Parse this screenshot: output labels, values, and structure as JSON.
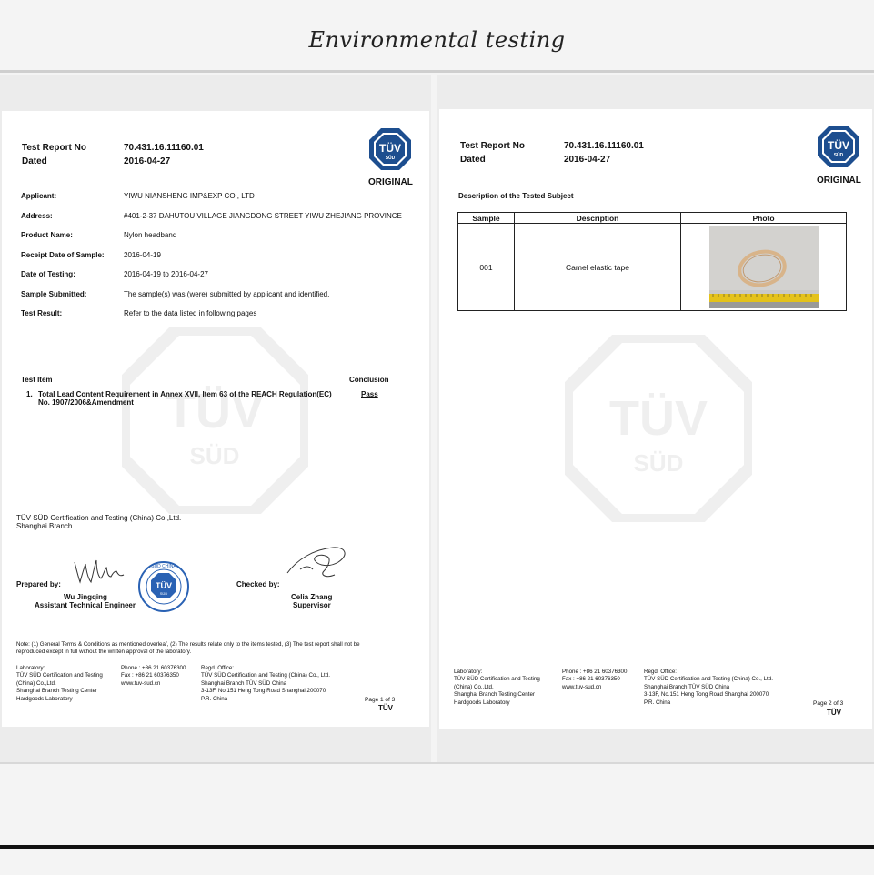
{
  "heading": "Environmental testing",
  "page1": {
    "labels": {
      "report_no": "Test Report No",
      "dated": "Dated"
    },
    "report_no": "70.431.16.11160.01",
    "dated": "2016-04-27",
    "original": "ORIGINAL",
    "logo_top": "TÜV",
    "logo_bottom": "SÜD",
    "fields": [
      {
        "label": "Applicant:",
        "value": "YIWU NIANSHENG IMP&EXP CO., LTD"
      },
      {
        "label": "Address:",
        "value": "#401-2-37 DAHUTOU VILLAGE JIANGDONG STREET YIWU ZHEJIANG PROVINCE"
      },
      {
        "label": "Product Name:",
        "value": "Nylon headband"
      },
      {
        "label": "Receipt Date of Sample:",
        "value": "2016-04-19"
      },
      {
        "label": "Date of Testing:",
        "value": "2016-04-19 to 2016-04-27"
      },
      {
        "label": "Sample Submitted:",
        "value": "The sample(s) was (were) submitted by applicant and identified."
      },
      {
        "label": "Test Result:",
        "value": "Refer to the data listed in following pages"
      }
    ],
    "test_item_header": "Test Item",
    "conclusion_header": "Conclusion",
    "test_num": "1.",
    "test_line1": "Total Lead Content Requirement in Annex XVII, Item 63 of the REACH Regulation(EC)",
    "test_line2": "No. 1907/2006&Amendment",
    "conclusion": "Pass",
    "company_line1": "TÜV SÜD Certification and Testing (China) Co.,Ltd.",
    "company_line2": "Shanghai Branch",
    "prepared_label": "Prepared  by:",
    "prepared_name": "Wu Jingqing",
    "prepared_title": "Assistant Technical Engineer",
    "checked_label": "Checked by:",
    "checked_name": "Celia Zhang",
    "checked_title": "Supervisor",
    "stamp_text": "SÜD CHINA",
    "note_line1": "Note: (1) General Terms & Conditions as mentioned overleaf, (2) The results relate only to the items tested, (3) The test report shall not be",
    "note_line2": "reproduced except in full without the written approval of the laboratory.",
    "footer": {
      "lab": [
        "Laboratory:",
        "TÜV SÜD Certification and Testing",
        "(China) Co.,Ltd.",
        "Shanghai Branch Testing Center",
        "Hardgoods Laboratory"
      ],
      "contact": [
        "Phone : +86 21 60376300",
        "Fax : +86 21 60376350",
        "www.tuv-sud.cn"
      ],
      "office": [
        "Regd. Office:",
        "TÜV SÜD Certification and Testing (China) Co., Ltd.",
        "Shanghai Branch TÜV SÜD China",
        "3-13F, No.151 Heng Tong Road Shanghai 200070",
        "P.R. China"
      ],
      "page": "Page 1 of 3",
      "mark": "TÜV"
    }
  },
  "page2": {
    "labels": {
      "report_no": "Test Report No",
      "dated": "Dated"
    },
    "report_no": "70.431.16.11160.01",
    "dated": "2016-04-27",
    "original": "ORIGINAL",
    "logo_top": "TÜV",
    "logo_bottom": "SÜD",
    "section_title": "Description of the Tested Subject",
    "table_headers": [
      "Sample",
      "Description",
      "Photo"
    ],
    "rows": [
      {
        "sample": "001",
        "description": "Camel elastic tape"
      }
    ],
    "footer": {
      "lab": [
        "Laboratory:",
        "TÜV SÜD Certification and Testing",
        "(China) Co.,Ltd.",
        "Shanghai Branch Testing Center",
        "Hardgoods Laboratory"
      ],
      "contact": [
        "Phone : +86 21 60376300",
        "Fax : +86 21 60376350",
        "www.tuv-sud.cn"
      ],
      "office": [
        "Regd. Office:",
        "TÜV SÜD Certification and Testing (China) Co., Ltd.",
        "Shanghai Branch TÜV SÜD China",
        "3-13F, No.151 Heng Tong Road Shanghai 200070",
        "P.R. China"
      ],
      "page": "Page 2 of 3",
      "mark": "TÜV"
    }
  },
  "colors": {
    "tuv_blue": "#1d4e8f",
    "watermark": "#7a7a7a"
  }
}
